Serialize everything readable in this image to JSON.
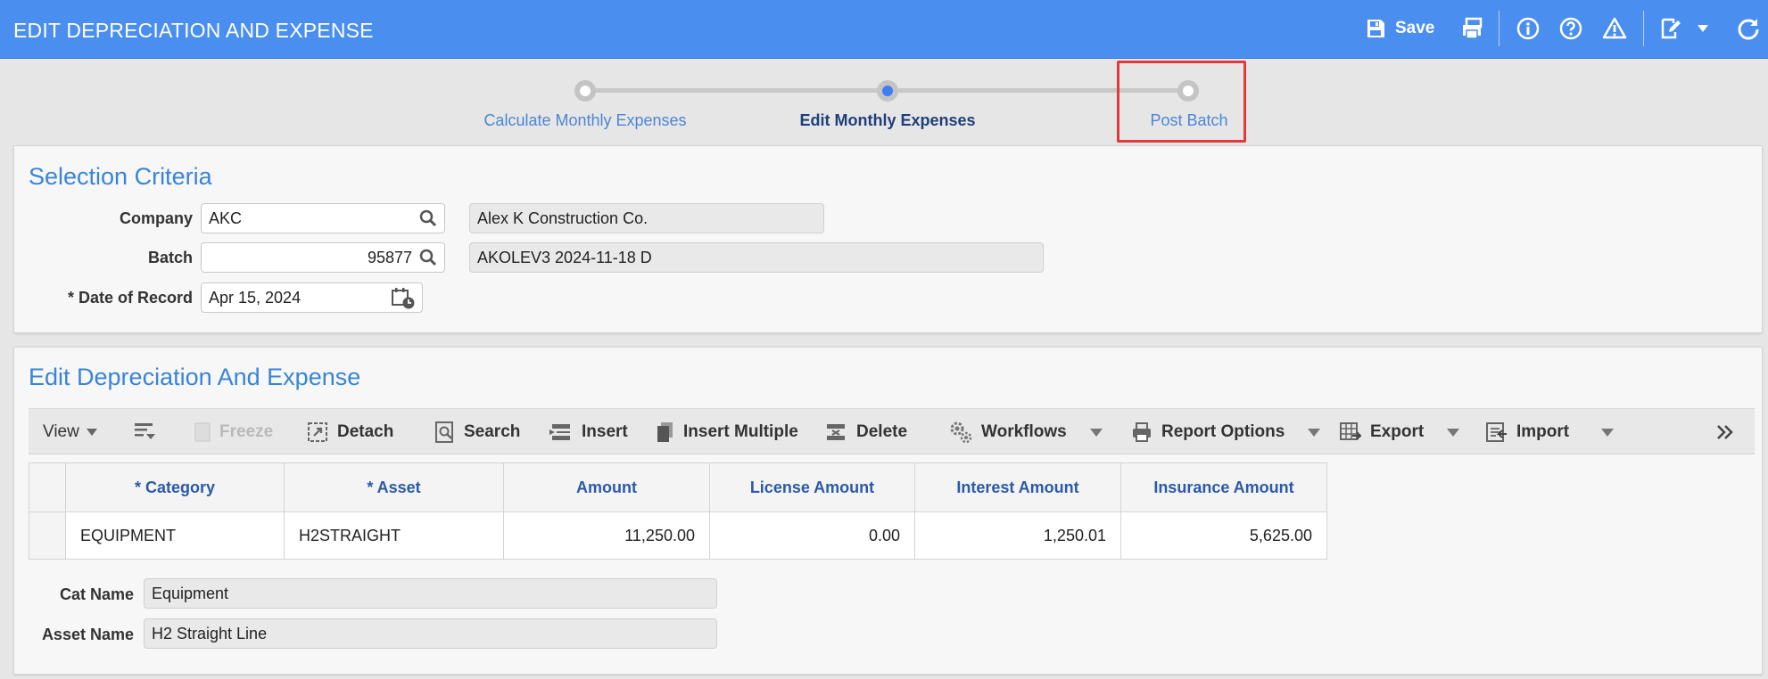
{
  "header": {
    "title": "EDIT DEPRECIATION AND EXPENSE",
    "save_label": "Save"
  },
  "stepper": {
    "steps": [
      {
        "label": "Calculate Monthly Expenses",
        "state": "done"
      },
      {
        "label": "Edit Monthly Expenses",
        "state": "active"
      },
      {
        "label": "Post Batch",
        "state": "pending"
      }
    ]
  },
  "selection": {
    "title": "Selection Criteria",
    "company_label": "Company",
    "company_value": "AKC",
    "company_name": "Alex K Construction Co.",
    "batch_label": "Batch",
    "batch_value": "95877",
    "batch_desc": "AKOLEV3 2024-11-18 D",
    "date_label": "* Date of Record",
    "date_value": "Apr 15, 2024"
  },
  "edit": {
    "title": "Edit Depreciation And Expense",
    "toolbar": {
      "view": "View",
      "freeze": "Freeze",
      "detach": "Detach",
      "search": "Search",
      "insert": "Insert",
      "insert_multiple": "Insert Multiple",
      "delete": "Delete",
      "workflows": "Workflows",
      "report_options": "Report Options",
      "export": "Export",
      "import": "Import"
    },
    "columns": [
      "* Category",
      "* Asset",
      "Amount",
      "License Amount",
      "Interest Amount",
      "Insurance Amount"
    ],
    "rows": [
      {
        "category": "EQUIPMENT",
        "asset": "H2STRAIGHT",
        "amount": "11,250.00",
        "license": "0.00",
        "interest": "1,250.01",
        "insurance": "5,625.00"
      }
    ],
    "cat_name_label": "Cat Name",
    "cat_name_value": "Equipment",
    "asset_name_label": "Asset Name",
    "asset_name_value": "H2 Straight Line"
  },
  "colors": {
    "header_bg": "#4a8ef0",
    "accent": "#3a84d8",
    "highlight": "#e03a3a"
  }
}
